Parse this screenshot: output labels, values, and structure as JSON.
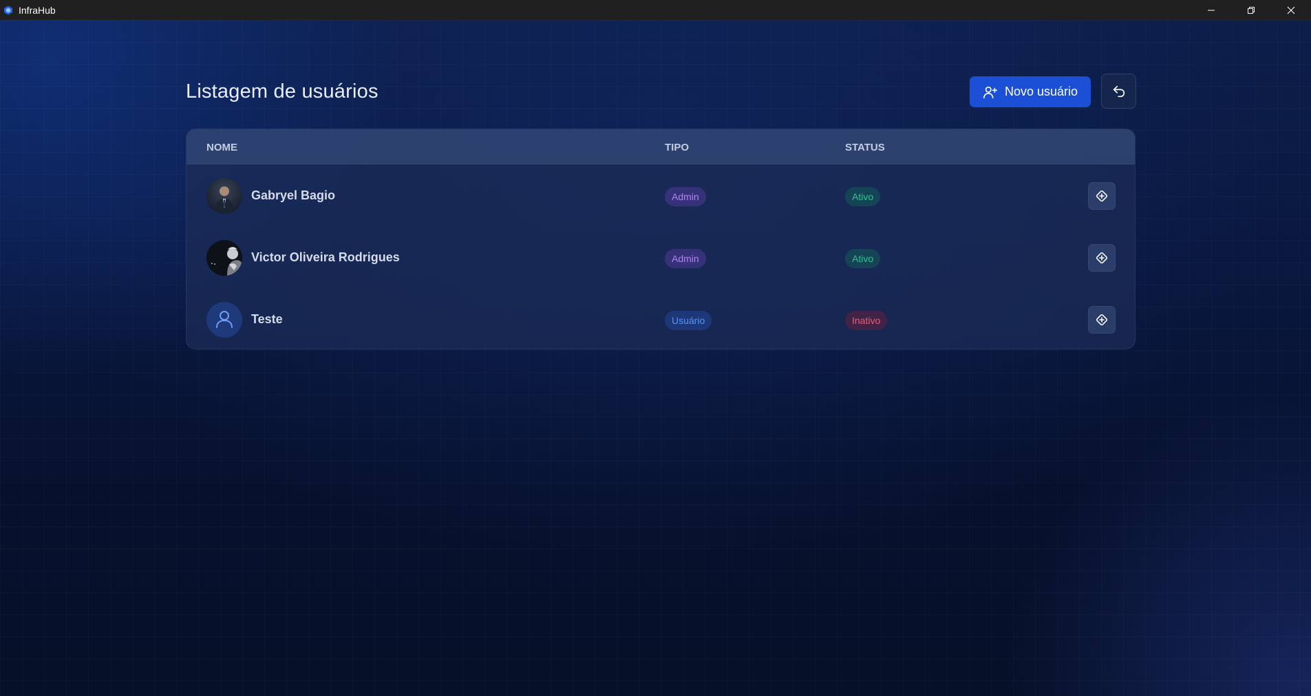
{
  "window": {
    "title": "InfraHub",
    "controls": [
      "minimize-icon",
      "restore-icon",
      "close-icon"
    ]
  },
  "header": {
    "title": "Listagem de usuários",
    "new_user_label": "Novo usuário",
    "new_user_icon": "user-plus-icon",
    "back_icon": "undo-arrow-icon"
  },
  "table": {
    "columns": [
      "NOME",
      "TIPO",
      "STATUS"
    ],
    "rows": [
      {
        "name": "Gabryel Bagio",
        "type": "Admin",
        "status": "Ativo",
        "avatar": "photo",
        "action_icon": "diamond-plus-icon"
      },
      {
        "name": "Victor Oliveira Rodrigues",
        "type": "Admin",
        "status": "Ativo",
        "avatar": "photo",
        "action_icon": "diamond-plus-icon"
      },
      {
        "name": "Teste",
        "type": "Usuário",
        "status": "Inativo",
        "avatar": "user-placeholder-icon",
        "action_icon": "diamond-plus-icon"
      }
    ]
  },
  "colors": {
    "accent": "#1a4fd6",
    "admin_badge": "#b083f0",
    "user_badge": "#5b93f2",
    "active_badge": "#2ec391",
    "inactive_badge": "#ee5c78"
  }
}
